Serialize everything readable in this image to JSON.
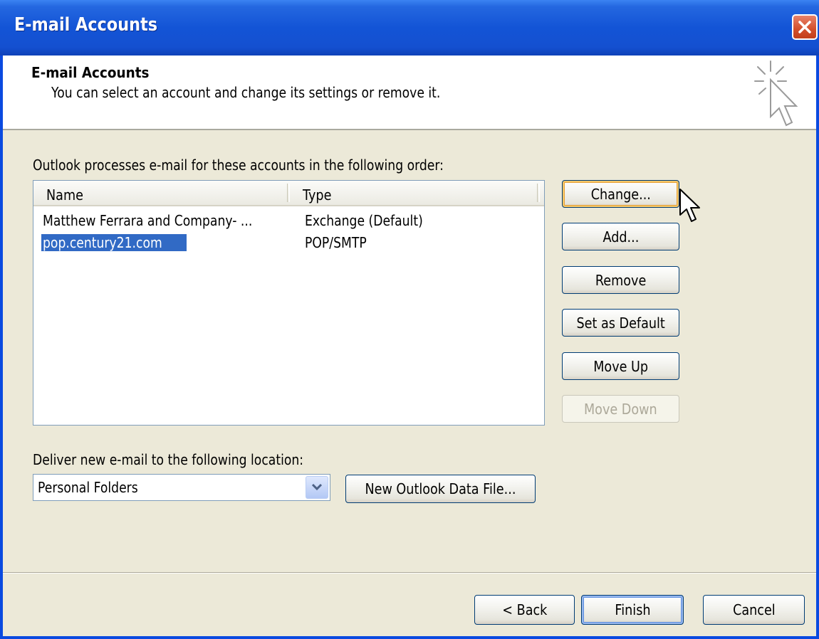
{
  "window": {
    "title": "E-mail Accounts"
  },
  "header": {
    "title": "E-mail Accounts",
    "subtitle": "You can select an account and change its settings or remove it.",
    "icon": "pointer-sparkle-icon"
  },
  "accounts": {
    "label": "Outlook processes e-mail for these accounts in the following order:",
    "columns": [
      "Name",
      "Type"
    ],
    "rows": [
      {
        "name": "Matthew Ferrara and Company- ...",
        "type": "Exchange (Default)",
        "selected": false
      },
      {
        "name": "pop.century21.com",
        "type": "POP/SMTP",
        "selected": true
      }
    ]
  },
  "side_buttons": {
    "change": "Change...",
    "add": "Add...",
    "remove": "Remove",
    "set_default": "Set as Default",
    "move_up": "Move Up",
    "move_down": "Move Down"
  },
  "deliver": {
    "label": "Deliver new e-mail to the following location:",
    "selected": "Personal Folders",
    "new_file_button": "New Outlook Data File..."
  },
  "footer": {
    "back": "< Back",
    "finish": "Finish",
    "cancel": "Cancel"
  },
  "colors": {
    "titlebar": "#1354d6",
    "selection": "#316ac5",
    "dialog_bg": "#ece9d8"
  }
}
